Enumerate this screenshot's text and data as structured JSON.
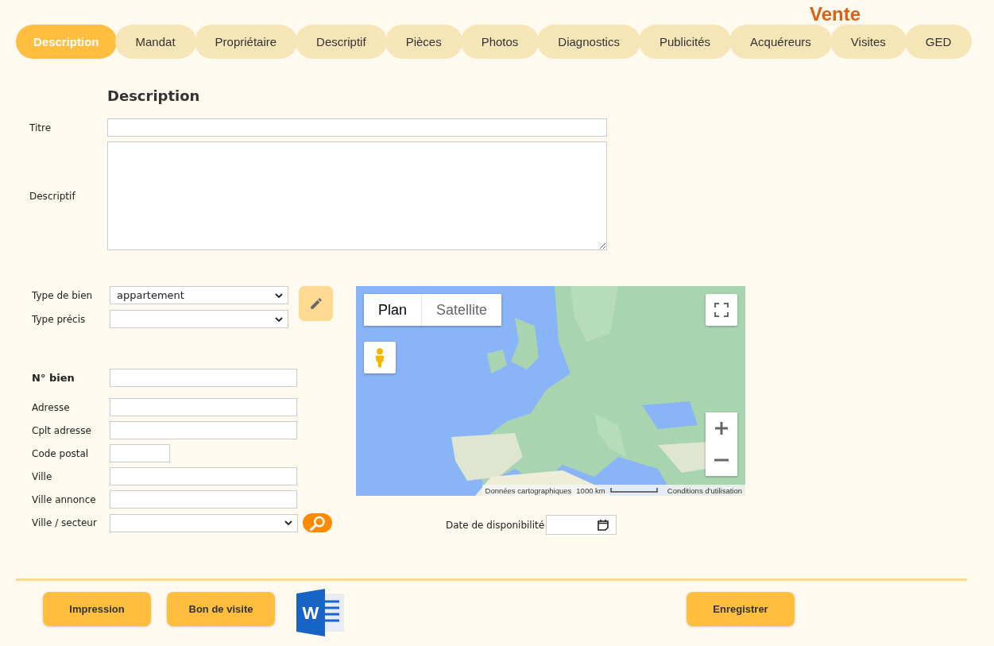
{
  "header": {
    "title": "Vente"
  },
  "tabs": [
    {
      "label": "Description",
      "selected": true
    },
    {
      "label": "Mandat",
      "selected": false
    },
    {
      "label": "Propriétaire",
      "selected": false
    },
    {
      "label": "Descriptif",
      "selected": false
    },
    {
      "label": "Pièces",
      "selected": false
    },
    {
      "label": "Photos",
      "selected": false
    },
    {
      "label": "Diagnostics",
      "selected": false
    },
    {
      "label": "Publicités",
      "selected": false
    },
    {
      "label": "Acquéreurs",
      "selected": false
    },
    {
      "label": "Visites",
      "selected": false
    },
    {
      "label": "GED",
      "selected": false
    }
  ],
  "section_title": "Description",
  "text_fields": [
    {
      "label": "Titre",
      "kind": "input"
    },
    {
      "label": "Descriptif",
      "kind": "textarea"
    }
  ],
  "property_type": [
    {
      "label": "Type de bien",
      "value": "appartement"
    },
    {
      "label": "Type précis"
    }
  ],
  "identity_fields": [
    {
      "label": "N° bien",
      "kind": "text",
      "emphasis": true
    },
    {
      "label": "Adresse",
      "kind": "text",
      "emphasis": false
    },
    {
      "label": "Cplt adresse",
      "kind": "text",
      "emphasis": false
    },
    {
      "label": "Code postal",
      "kind": "short",
      "emphasis": false
    },
    {
      "label": "Ville",
      "kind": "text",
      "emphasis": false
    },
    {
      "label": "Ville annonce",
      "kind": "text",
      "emphasis": false
    },
    {
      "label": "Ville / secteur",
      "kind": "select",
      "emphasis": false
    }
  ],
  "map": {
    "map_type": [
      {
        "label": "Plan",
        "selected": true
      },
      {
        "label": "Satellite",
        "selected": false
      }
    ],
    "data_credit": "Données cartographiques",
    "scale": "1000 km",
    "terms": "Conditions d'utilisation"
  },
  "availability": {
    "label": "Date de disponibilité"
  },
  "actions": [
    {
      "label": "Impression"
    },
    {
      "label": "Bon de visite"
    }
  ],
  "word_export": {
    "letter": "W"
  },
  "save": {
    "label": "Enregistrer"
  }
}
